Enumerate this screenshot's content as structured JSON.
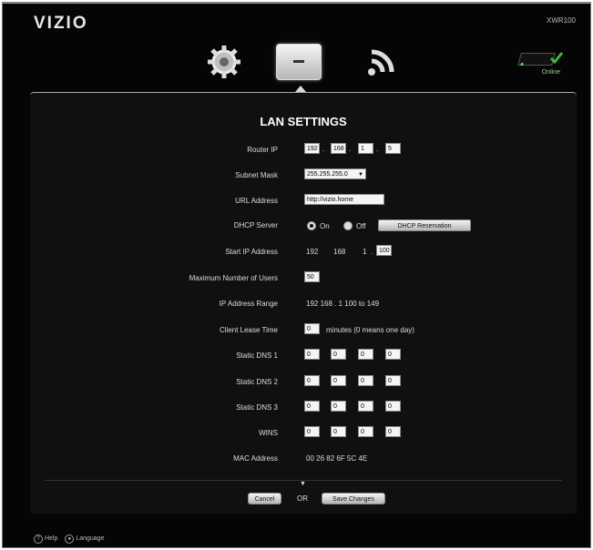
{
  "app": {
    "brand": "VIZIO",
    "model": "XWR100"
  },
  "status": {
    "label": "Online",
    "accent": "#4ff84f"
  },
  "nav": {
    "items": [
      {
        "label": "",
        "icon": "gear-icon"
      },
      {
        "label": "",
        "icon": "router-icon"
      },
      {
        "label": "",
        "icon": "wifi-icon"
      }
    ]
  },
  "lan": {
    "title": "LAN SETTINGS",
    "router_ip": {
      "label": "Router IP",
      "octets": [
        "192",
        "168",
        "1",
        "5"
      ]
    },
    "subnet_mask": {
      "label": "Subnet Mask",
      "value": "255.255.255.0"
    },
    "url_address": {
      "label": "URL Address",
      "value": "http://vizio.home"
    },
    "dhcp_server": {
      "label": "DHCP Server",
      "on_label": "On",
      "off_label": "Off",
      "selected": "On",
      "reservation_button": "DHCP Reservation"
    },
    "start_ip": {
      "label": "Start IP Address",
      "prefix": [
        "192",
        "168",
        "1"
      ],
      "last_octet": "100"
    },
    "max_users": {
      "label": "Maximum Number of Users",
      "value": "50"
    },
    "ip_range": {
      "label": "IP Address Range",
      "value": "192   168 .  1     100 to 149"
    },
    "lease_time": {
      "label": "Client Lease Time",
      "value": "0",
      "suffix": "minutes (0 means one day)"
    },
    "static_dns_1": {
      "label": "Static DNS 1",
      "octets": [
        "0",
        "0",
        "0",
        "0"
      ]
    },
    "static_dns_2": {
      "label": "Static DNS 2",
      "octets": [
        "0",
        "0",
        "0",
        "0"
      ]
    },
    "static_dns_3": {
      "label": "Static DNS 3",
      "octets": [
        "0",
        "0",
        "0",
        "0"
      ]
    },
    "wins": {
      "label": "WINS",
      "octets": [
        "0",
        "0",
        "0",
        "0"
      ]
    },
    "mac_address": {
      "label": "MAC Address",
      "value": "00 26 82 6F 5C 4E"
    }
  },
  "actions": {
    "cancel": "Cancel",
    "or": "OR",
    "save": "Save Changes"
  },
  "footer": {
    "help": "Help",
    "language": "Language"
  }
}
